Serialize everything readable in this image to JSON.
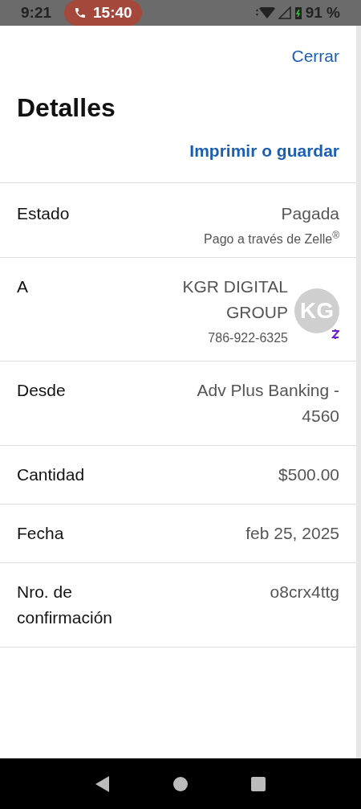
{
  "status_bar": {
    "time": "9:21",
    "call_time": "15:40",
    "battery": "91 %"
  },
  "header": {
    "close": "Cerrar",
    "title": "Detalles",
    "print": "Imprimir o guardar"
  },
  "rows": [
    {
      "kind": "text",
      "label": "Estado",
      "value": "Pagada",
      "note": "Pago a través de Zelle$^{®}$"
    },
    {
      "kind": "contact",
      "label": "A",
      "value": "KGR DIGITAL GROUP",
      "note": "786-922-6325",
      "initials": "KG"
    },
    {
      "kind": "text",
      "label": "Desde",
      "value": "Adv Plus Banking - 4560"
    },
    {
      "kind": "text",
      "label": "Cantidad",
      "value": "$500.00"
    },
    {
      "kind": "text",
      "label": "Fecha",
      "value": "feb 25, 2025"
    },
    {
      "kind": "text",
      "label": "Nro. de confirmación",
      "value": "o8crx4ttg"
    }
  ]
}
